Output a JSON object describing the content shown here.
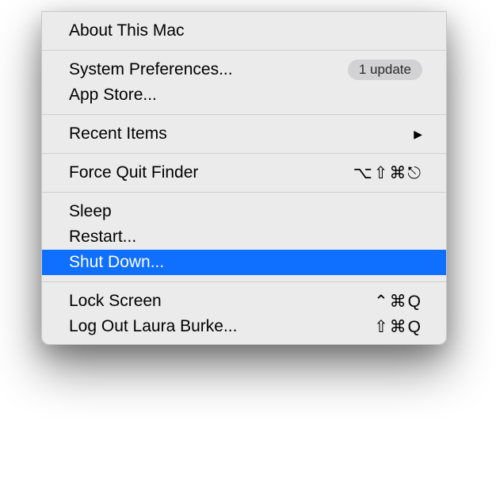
{
  "menu": {
    "about": "About This Mac",
    "systemPreferences": "System Preferences...",
    "updateBadge": "1 update",
    "appStore": "App Store...",
    "recentItems": "Recent Items",
    "forceQuit": "Force Quit Finder",
    "forceQuitShortcut": "⌥⇧⌘⎋",
    "sleep": "Sleep",
    "restart": "Restart...",
    "shutDown": "Shut Down...",
    "lockScreen": "Lock Screen",
    "lockScreenShortcut": "⌃⌘Q",
    "logOut": "Log Out Laura Burke...",
    "logOutShortcut": "⇧⌘Q"
  },
  "icons": {
    "submenuArrow": "▶"
  }
}
